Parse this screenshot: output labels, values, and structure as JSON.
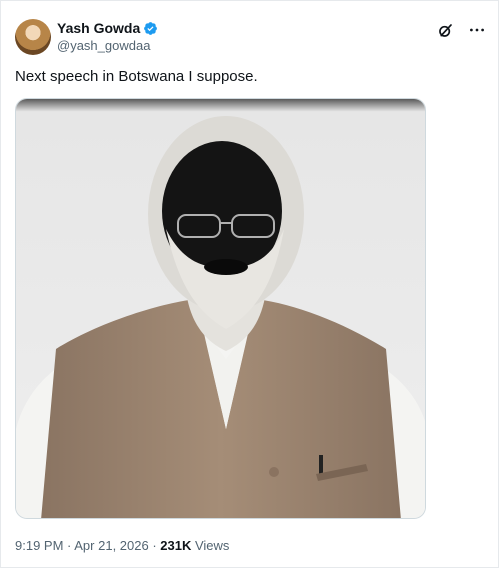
{
  "author": {
    "display_name": "Yash Gowda",
    "handle": "@yash_gowdaa",
    "verified": true
  },
  "tweet": {
    "text": "Next speech in Botswana I suppose."
  },
  "media": {
    "alt": ""
  },
  "meta": {
    "time": "9:19 PM",
    "separator1": " · ",
    "date": "Apr 21, 2026",
    "separator2": " · ",
    "views_count": "231K",
    "views_label": " Views"
  },
  "icons": {
    "grok": "grok-icon",
    "more": "more-options-icon",
    "verified": "verified-badge-icon"
  },
  "colors": {
    "text_primary": "#0f1419",
    "text_secondary": "#536471",
    "verified_blue": "#1d9bf0",
    "border": "#cfd9de"
  }
}
